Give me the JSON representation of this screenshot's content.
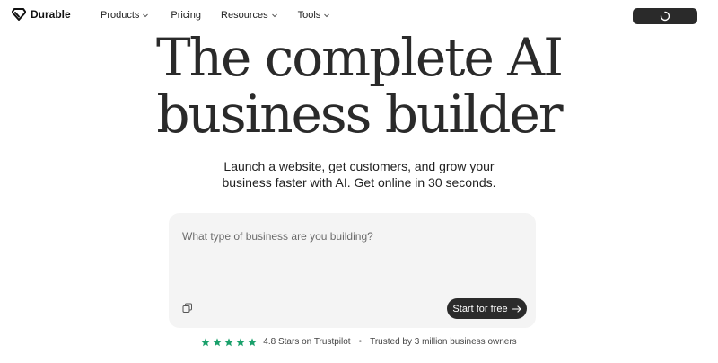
{
  "nav": {
    "logo_text": "Durable",
    "items": [
      {
        "label": "Products",
        "has_dropdown": true
      },
      {
        "label": "Pricing",
        "has_dropdown": false
      },
      {
        "label": "Resources",
        "has_dropdown": true
      },
      {
        "label": "Tools",
        "has_dropdown": true
      }
    ],
    "cta_state": "loading"
  },
  "hero": {
    "title_line1": "The complete AI",
    "title_line2": "business builder",
    "subtitle_line1": "Launch a website, get customers, and grow your",
    "subtitle_line2": "business faster with AI. Get online in 30 seconds."
  },
  "prompt": {
    "placeholder": "What type of business are you building?",
    "value": "",
    "start_label": "Start for free",
    "start_icon": "arrow-right-icon",
    "copy_icon": "copy-icon"
  },
  "trust": {
    "stars": 5,
    "rating_text": "4.8 Stars on Trustpilot",
    "separator": "•",
    "trusted_text": "Trusted by 3 million business owners",
    "star_color": "#1aa06b"
  },
  "colors": {
    "dark": "#2a2a2a",
    "prompt_bg": "#f4f4f4",
    "star": "#1aa06b"
  }
}
